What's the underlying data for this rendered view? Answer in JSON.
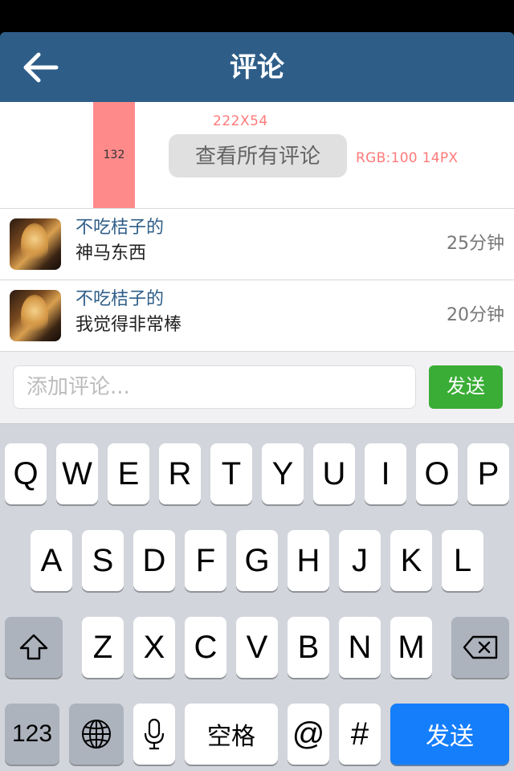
{
  "nav": {
    "title": "评论",
    "back_icon": "arrow-left-icon"
  },
  "annotations": {
    "measure_value": "132",
    "size_label": "222X54",
    "rgb_label": "RGB:100  14PX"
  },
  "view_all_button": "查看所有评论",
  "comments": [
    {
      "author": "不吃桔子的",
      "text": "神马东西",
      "time": "25分钟"
    },
    {
      "author": "不吃桔子的",
      "text": "我觉得非常棒",
      "time": "20分钟"
    }
  ],
  "input": {
    "placeholder": "添加评论...",
    "send_label": "发送"
  },
  "keyboard": {
    "row1": [
      "Q",
      "W",
      "E",
      "R",
      "T",
      "Y",
      "U",
      "I",
      "O",
      "P"
    ],
    "row2": [
      "A",
      "S",
      "D",
      "F",
      "G",
      "H",
      "J",
      "K",
      "L"
    ],
    "row3": [
      "Z",
      "X",
      "C",
      "V",
      "B",
      "N",
      "M"
    ],
    "numbers_label": "123",
    "space_label": "空格",
    "at_label": "@",
    "hash_label": "#",
    "send_label": "发送"
  },
  "colors": {
    "nav_bg": "#2e5e88",
    "send_green": "#3aad36",
    "keyboard_send_blue": "#157efb",
    "annotation_red": "#ff7a7a"
  }
}
